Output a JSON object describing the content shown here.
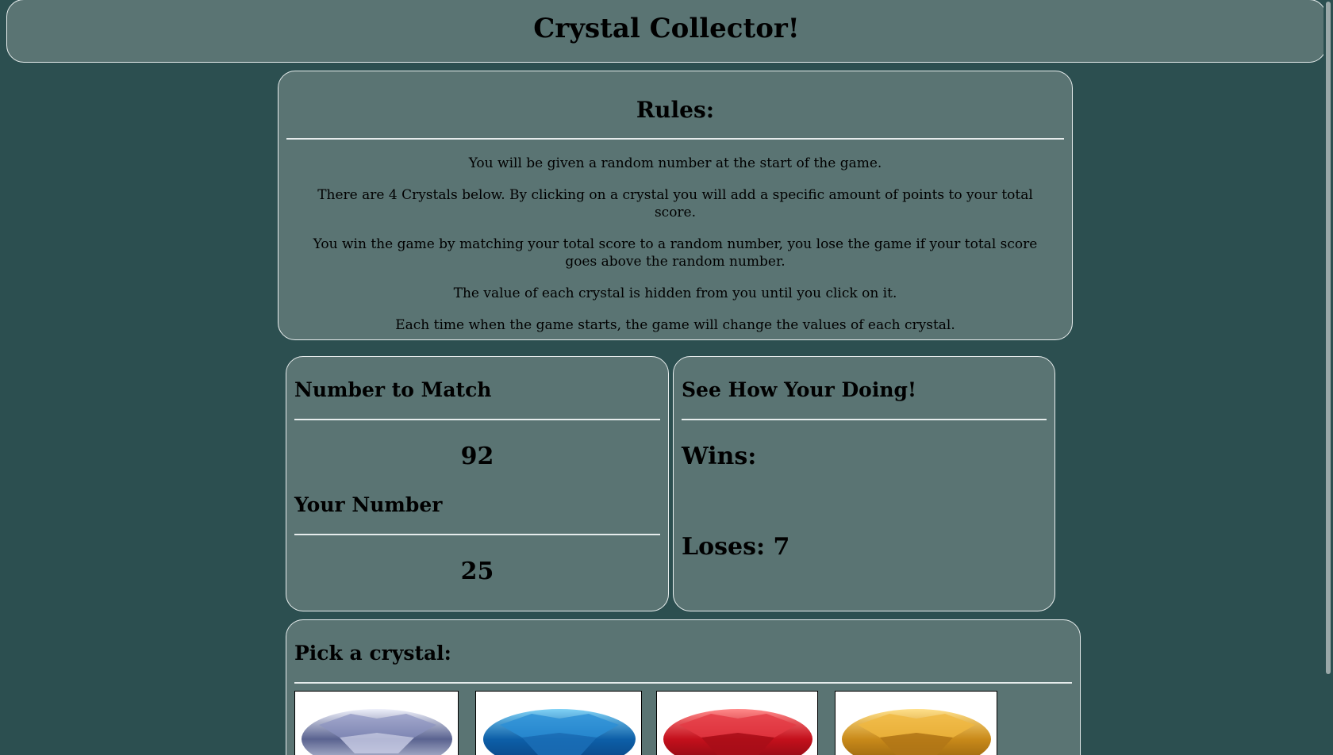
{
  "header": {
    "title": "Crystal Collector!"
  },
  "rules": {
    "title": "Rules:",
    "lines": [
      "You will be given a random number at the start of the game.",
      "There are 4 Crystals below. By clicking on a crystal you will add a specific amount of points to your total score.",
      "You win the game by matching your total score to a random number, you lose the game if your total score goes above the random number.",
      "The value of each crystal is hidden from you until you click on it.",
      "Each time when the game starts, the game will change the values of each crystal."
    ]
  },
  "match": {
    "title": "Number to Match",
    "value": "92",
    "your_title": "Your Number",
    "your_value": "25"
  },
  "stats": {
    "title": "See How Your Doing!",
    "wins_label": "Wins:",
    "loses_label": "Loses: 7"
  },
  "crystals": {
    "title": "Pick a crystal:",
    "items": [
      {
        "name": "clear-crystal-icon",
        "color": "#b9bfd9"
      },
      {
        "name": "blue-crystal-icon",
        "color": "#1f7fc4"
      },
      {
        "name": "red-crystal-icon",
        "color": "#d8202a"
      },
      {
        "name": "gold-crystal-icon",
        "color": "#e0a030"
      }
    ]
  }
}
